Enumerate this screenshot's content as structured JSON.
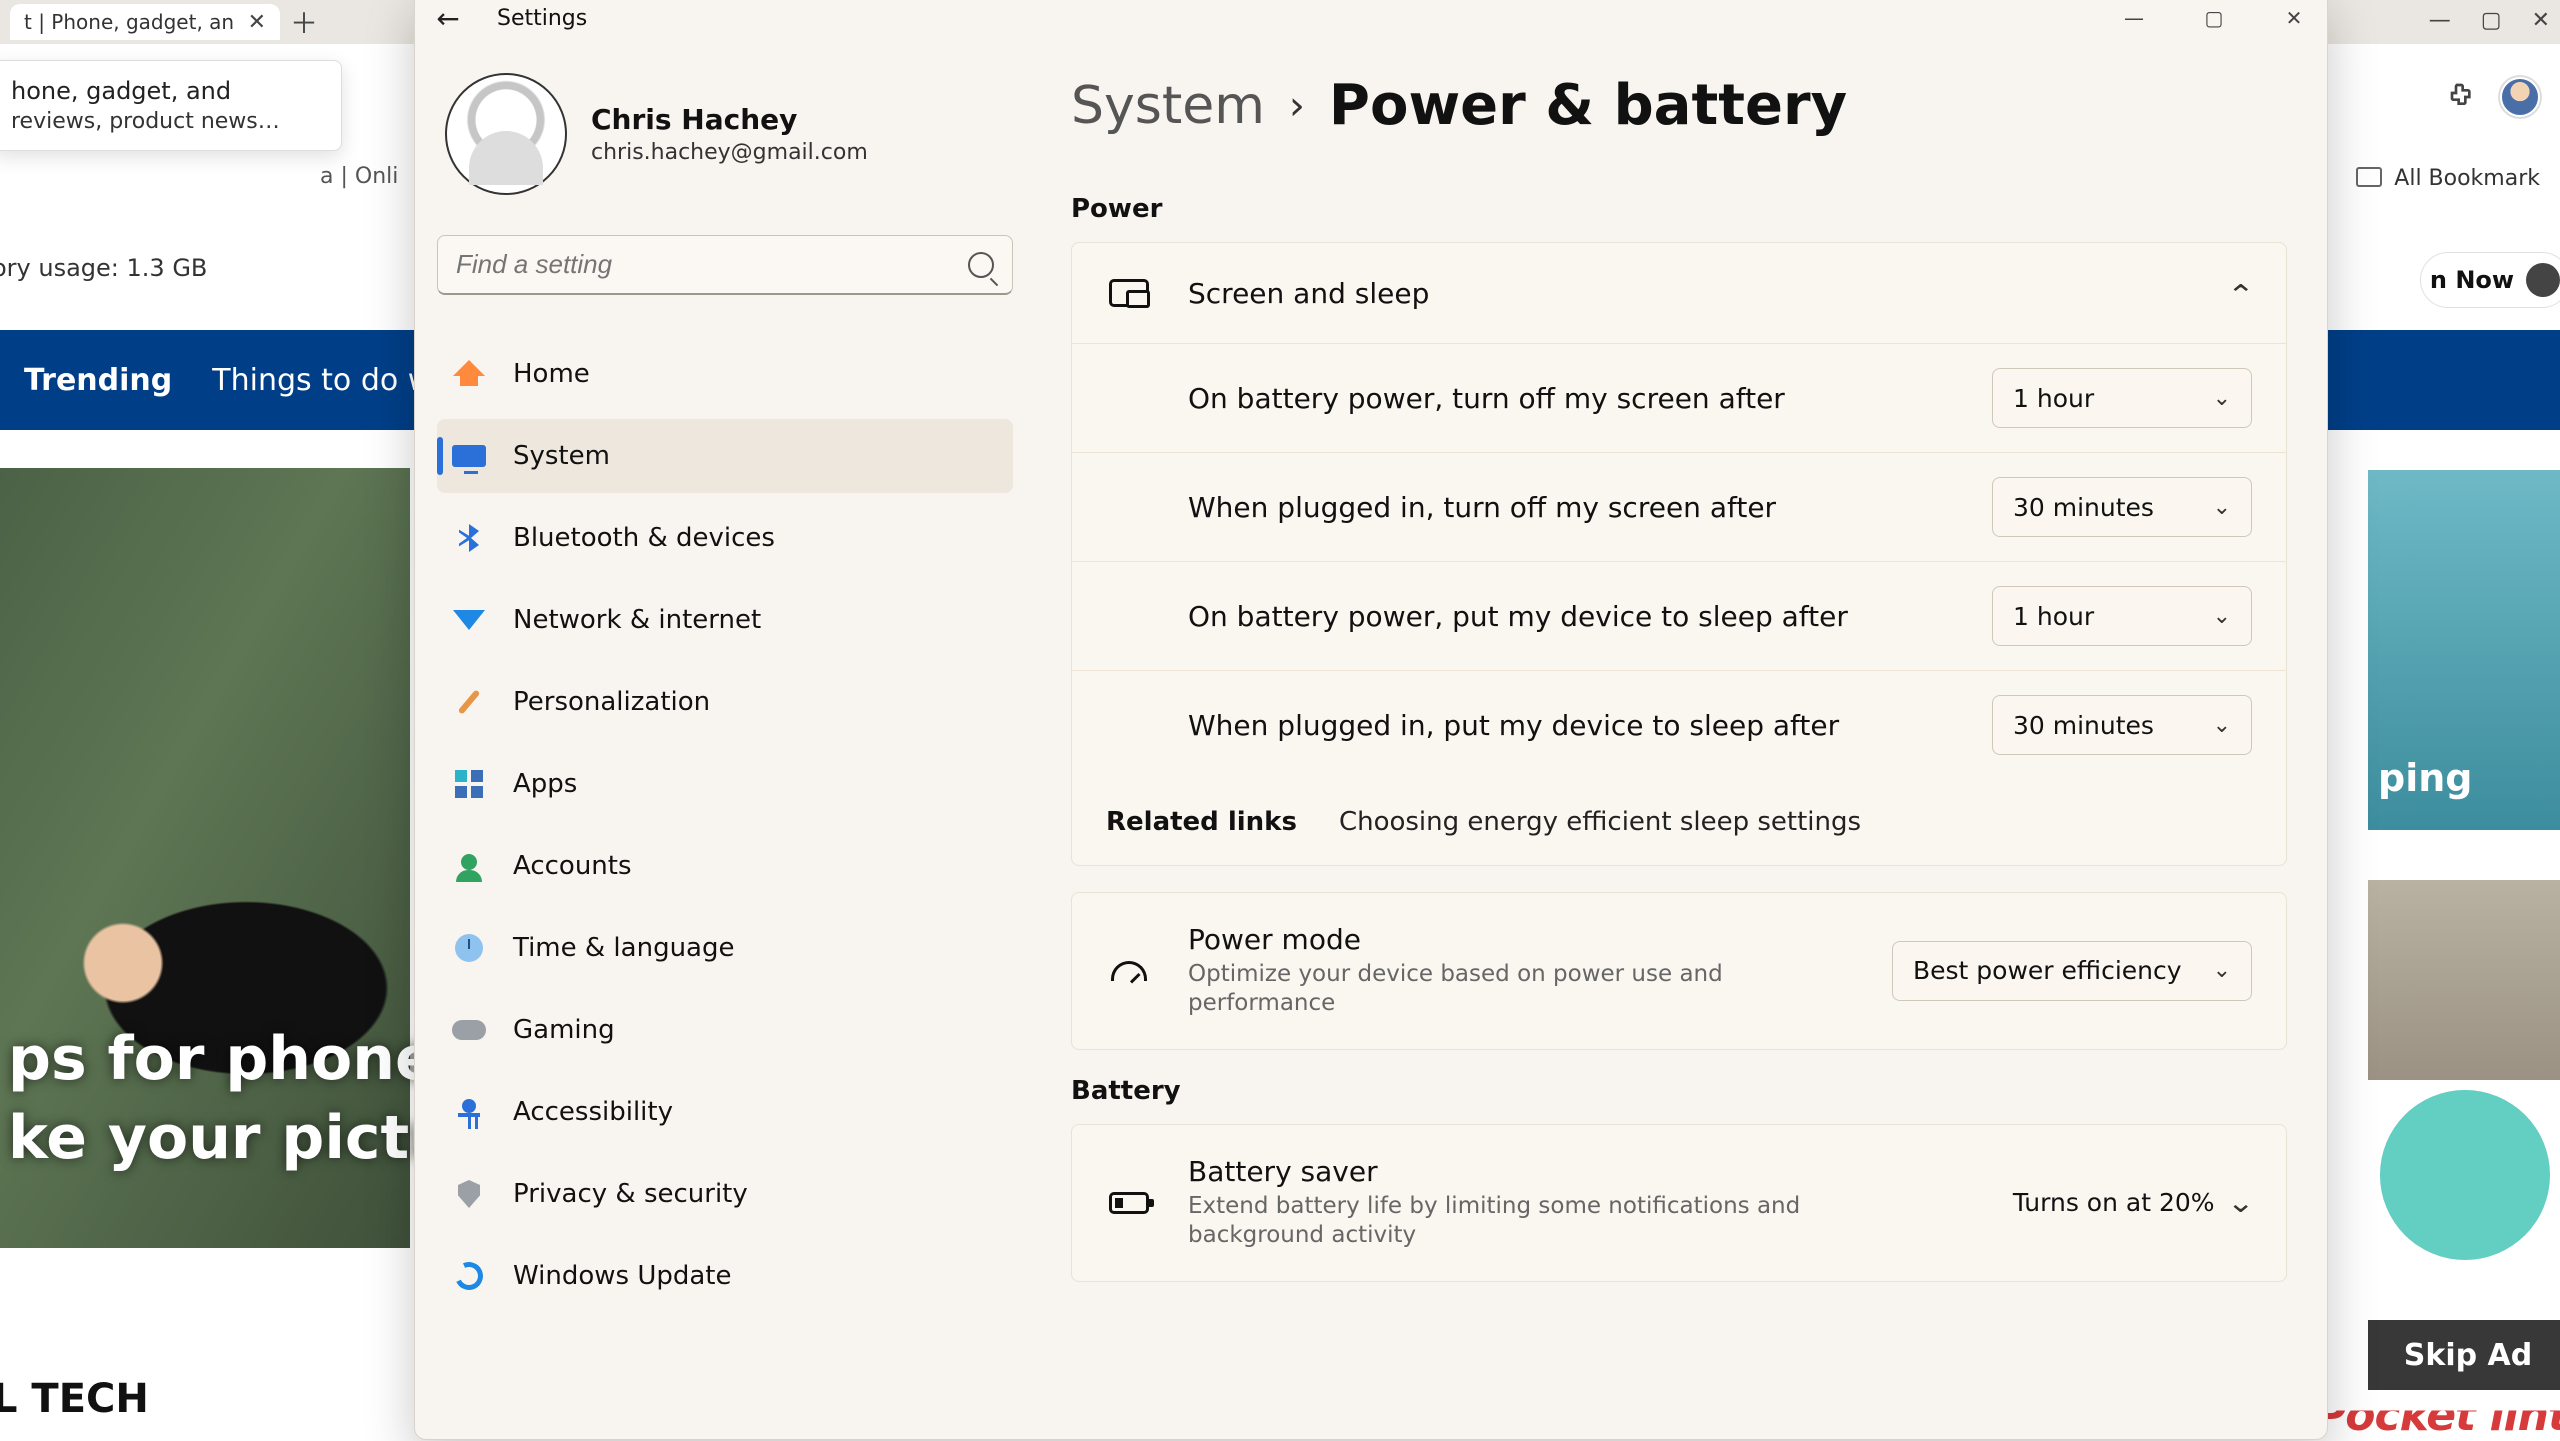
{
  "browser": {
    "tab_title": "t | Phone, gadget, an",
    "tooltip_line1": "hone, gadget, and",
    "tooltip_line2": " reviews, product news…",
    "tooltip_url_fragment": "a | Onli",
    "memory_usage": "ory usage: 1.3 GB",
    "bookmark_all": "All Bookmark",
    "sign_in": "n Now",
    "skip_ad": "Skip Ad",
    "watermark": "Pocket lint",
    "bluebar1": "Trending",
    "bluebar2": "Things to do with",
    "hero_text": "ps for phone pl\nke your picture",
    "digital_tech": "L TECH",
    "thumb_tr_label": "ping"
  },
  "settings": {
    "title": "Settings",
    "profile": {
      "name": "Chris Hachey",
      "email": "chris.hachey@gmail.com"
    },
    "search_placeholder": "Find a setting",
    "nav": {
      "home": "Home",
      "system": "System",
      "bluetooth": "Bluetooth & devices",
      "network": "Network & internet",
      "personalization": "Personalization",
      "apps": "Apps",
      "accounts": "Accounts",
      "time": "Time & language",
      "gaming": "Gaming",
      "accessibility": "Accessibility",
      "privacy": "Privacy & security",
      "update": "Windows Update"
    },
    "breadcrumb": {
      "parent": "System",
      "sep": "›",
      "current": "Power & battery"
    },
    "section_power": "Power",
    "screen_sleep": {
      "title": "Screen and sleep",
      "batt_screen": "On battery power, turn off my screen after",
      "batt_screen_val": "1 hour",
      "plug_screen": "When plugged in, turn off my screen after",
      "plug_screen_val": "30 minutes",
      "batt_sleep": "On battery power, put my device to sleep after",
      "batt_sleep_val": "1 hour",
      "plug_sleep": "When plugged in, put my device to sleep after",
      "plug_sleep_val": "30 minutes"
    },
    "related_links": {
      "label": "Related links",
      "link": "Choosing energy efficient sleep settings"
    },
    "power_mode": {
      "title": "Power mode",
      "desc": "Optimize your device based on power use and performance",
      "value": "Best power efficiency"
    },
    "section_battery": "Battery",
    "battery_saver": {
      "title": "Battery saver",
      "desc": "Extend battery life by limiting some notifications and background activity",
      "status": "Turns on at 20%"
    }
  }
}
